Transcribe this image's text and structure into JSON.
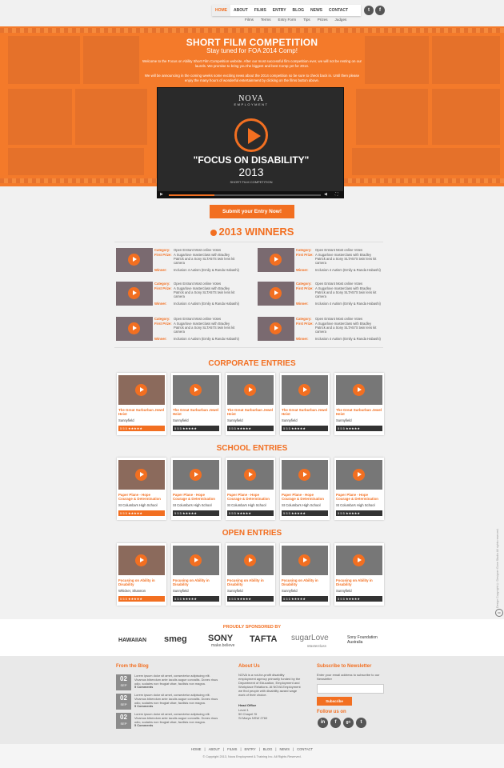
{
  "nav": {
    "items": [
      "HOME",
      "ABOUT",
      "FILMS",
      "ENTRY",
      "BLOG",
      "NEWS",
      "CONTACT"
    ],
    "social": {
      "twitter": "t",
      "facebook": "f"
    },
    "sub_items": [
      "Films",
      "Terms",
      "Entry Form",
      "Tips",
      "Prizes",
      "Judges"
    ]
  },
  "hero": {
    "title": "SHORT FILM COMPETITION",
    "subtitle": "Stay tuned for FOA 2014 Comp!",
    "para1": "Welcome to the Focus on Ability Short Film Competition website. After our most successful film competition ever, we will not be resting on our laurels. We promise to bring you the biggest and best Comp yet for 2014.",
    "para2": "We will be announcing in the coming weeks some exciting news about the 2014 competition so be sure to check back in. Until then please enjoy the many hours of wonderful entertainment by clicking on the films button above.",
    "video": {
      "logo": "NOVA",
      "logo_sub": "EMPLOYMENT",
      "title": "\"FOCUS ON DISABILITY\"",
      "year": "2013",
      "caption": "SHORT FILM COMPETITION",
      "progress": 0.3
    }
  },
  "submit_label": "Submit your Entry Now!",
  "winners": {
    "heading": "2013 WINNERS",
    "labels": {
      "category": "Category:",
      "first_prize": "First Prize:",
      "winner": "Winner:"
    },
    "rows": [
      {
        "category": "Open Entrant Most online Votes",
        "first_prize": "A Sugarlove masterclass with Bradley Patrick and a Sony SLTA57S twin lens kit camera",
        "winner": "Inclusion 4 Autism (Emily & Randa Habashi)"
      },
      {
        "category": "Open Entrant Most online Votes",
        "first_prize": "A Sugarlove masterclass with Bradley Patrick and a Sony SLTA57S twin lens kit camera",
        "winner": "Inclusion 4 Autism (Emily & Randa Habashi)"
      },
      {
        "category": "Open Entrant Most online Votes",
        "first_prize": "A Sugarlove masterclass with Bradley Patrick and a Sony SLTA57S twin lens kit camera",
        "winner": "Inclusion 4 Autism (Emily & Randa Habashi)"
      },
      {
        "category": "Open Entrant Most online Votes",
        "first_prize": "A Sugarlove masterclass with Bradley Patrick and a Sony SLTA57S twin lens kit camera",
        "winner": "Inclusion 4 Autism (Emily & Randa Habashi)"
      },
      {
        "category": "Open Entrant Most online Votes",
        "first_prize": "A Sugarlove masterclass with Bradley Patrick and a Sony SLTA57S twin lens kit camera",
        "winner": "Inclusion 4 Autism (Emily & Randa Habashi)"
      },
      {
        "category": "Open Entrant Most online Votes",
        "first_prize": "A Sugarlove masterclass with Bradley Patrick and a Sony SLTA57S twin lens kit camera",
        "winner": "Inclusion 4 Autism (Emily & Randa Habashi)"
      }
    ]
  },
  "corporate": {
    "heading": "CORPORATE ENTRIES",
    "cards": [
      {
        "title": "The Great Surburban Jewel Heist",
        "sub": "Sunnyfield",
        "stats": "5  5  5 ★★★★★"
      },
      {
        "title": "The Great Surburban Jewel Heist",
        "sub": "Sunnyfield",
        "stats": "5  5  5 ★★★★★"
      },
      {
        "title": "The Great Surburban Jewel Heist",
        "sub": "Sunnyfield",
        "stats": "5  5  5 ★★★★★"
      },
      {
        "title": "The Great Surburban Jewel Heist",
        "sub": "Sunnyfield",
        "stats": "5  5  5 ★★★★★"
      },
      {
        "title": "The Great Surburban Jewel Heist",
        "sub": "Sunnyfield",
        "stats": "5  5  5 ★★★★★"
      }
    ]
  },
  "school": {
    "heading": "SCHOOL ENTRIES",
    "cards": [
      {
        "title": "Paper Plane - Hope Courage & Determination",
        "sub": "St Columba's High School",
        "stats": "5  5  5 ★★★★★"
      },
      {
        "title": "Paper Plane - Hope Courage & Determination",
        "sub": "St Columba's High School",
        "stats": "5  5  5 ★★★★★"
      },
      {
        "title": "Paper Plane - Hope Courage & Determination",
        "sub": "St Columba's High School",
        "stats": "5  5  5 ★★★★★"
      },
      {
        "title": "Paper Plane - Hope Courage & Determination",
        "sub": "St Columba's High School",
        "stats": "5  5  5 ★★★★★"
      },
      {
        "title": "Paper Plane - Hope Courage & Determination",
        "sub": "St Columba's High School",
        "stats": "5  5  5 ★★★★★"
      }
    ]
  },
  "open": {
    "heading": "OPEN ENTRIES",
    "cards": [
      {
        "title": "Focusing on Ability in Disability",
        "sub": "Whicker, Shannon",
        "stats": "5  5  5 ★★★★★"
      },
      {
        "title": "Focusing on Ability in Disability",
        "sub": "Sunnyfield",
        "stats": "5  5  5 ★★★★★"
      },
      {
        "title": "Focusing on Ability in Disability",
        "sub": "Sunnyfield",
        "stats": "5  5  5 ★★★★★"
      },
      {
        "title": "Focusing on Ability in Disability",
        "sub": "Sunnyfield",
        "stats": "5  5  5 ★★★★★"
      },
      {
        "title": "Focusing on Ability in Disability",
        "sub": "Sunnyfield",
        "stats": "5  5  5 ★★★★★"
      }
    ]
  },
  "sponsors": {
    "heading": "PROUDLY SPONSORED BY",
    "logos": [
      "HAWAIIAN",
      "smeg",
      "SONY",
      "TAFTA",
      "sugarLove",
      "Sony Foundation Australia"
    ],
    "sony_tag": "make.believe",
    "sugar_tag": "Masterclass"
  },
  "footer": {
    "blog_h": "From the Blog",
    "posts": [
      {
        "day": "02",
        "month": "SEP",
        "text": "Lorem ipsum dolor sit amet, consectetur adipiscing elit. Vivamus bibendum ante iaculis augue convallis. Donec risus odio, sodales non feugiat vitae, facilisis non magna.",
        "comments": "5 Comments"
      },
      {
        "day": "02",
        "month": "SEP",
        "text": "Lorem ipsum dolor sit amet, consectetur adipiscing elit. Vivamus bibendum ante iaculis augue convallis. Donec risus odio, sodales non feugiat vitae, facilisis non magna.",
        "comments": "5 Comments"
      },
      {
        "day": "02",
        "month": "SEP",
        "text": "Lorem ipsum dolor sit amet, consectetur adipiscing elit. Vivamus bibendum ante iaculis augue convallis. Donec risus odio, sodales non feugiat vitae, facilisis non magna.",
        "comments": "5 Comments"
      }
    ],
    "about_h": "About Us",
    "about_text": "NOVA is a not-for-profit disability employment agency primarily funded by the Department of Education, Employment and Workplace Relations. At NOVA Employment we find people with disability award wage work of their choice.",
    "head_office_h": "Head Office",
    "address": [
      "Level 1",
      "50 Chapel St",
      "St Marys NSW 2760"
    ],
    "newsletter_h": "Subscribe to Newsletter",
    "newsletter_text": "Enter your email address to subscribe to our Newsletter",
    "subscribe_label": "Subscribe",
    "follow_h": "Follow us on",
    "follow_icons": [
      "in",
      "f",
      "g+",
      "t"
    ],
    "bottom_nav": [
      "HOME",
      "|",
      "ABOUT",
      "|",
      "FILMS",
      "|",
      "ENTRY",
      "|",
      "BLOG",
      "|",
      "NEWS",
      "|",
      "CONTACT"
    ],
    "copyright": "© Copyright 2013, Nova Employment & Training Inc. All Rights Reserved.",
    "vertical": "Design Copyright © Designer Gone Studio All rights reserved.",
    "cc": "cc"
  }
}
